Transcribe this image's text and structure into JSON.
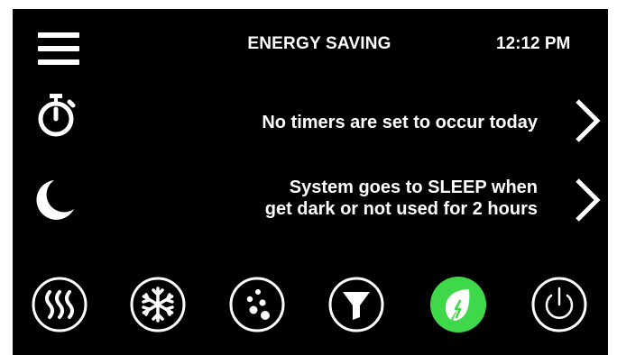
{
  "header": {
    "title": "ENERGY SAVING",
    "time": "12:12 PM",
    "menu_icon": "hamburger-menu-icon"
  },
  "rows": [
    {
      "icon": "stopwatch-icon",
      "text": "No timers are set to occur today"
    },
    {
      "icon": "moon-icon",
      "line1": "System goes to SLEEP when",
      "line2": "get dark or not used for 2 hours"
    }
  ],
  "modes": [
    {
      "icon": "heat-icon",
      "active": false
    },
    {
      "icon": "snowflake-icon",
      "active": false
    },
    {
      "icon": "dots-icon",
      "active": false
    },
    {
      "icon": "filter-icon",
      "active": false
    },
    {
      "icon": "leaf-icon",
      "active": true
    },
    {
      "icon": "power-icon",
      "active": false
    }
  ],
  "colors": {
    "background": "#000000",
    "foreground": "#ffffff",
    "active_mode": "#3fd84a"
  }
}
